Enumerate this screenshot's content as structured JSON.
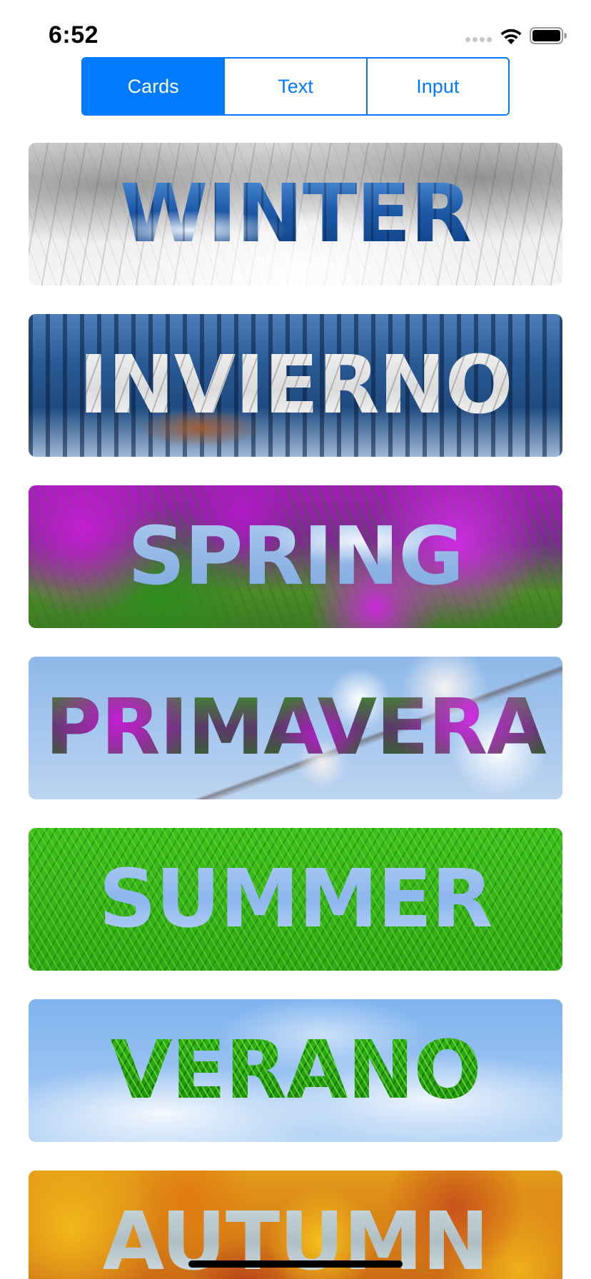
{
  "status_bar": {
    "time": "6:52"
  },
  "segmented_control": {
    "segments": [
      {
        "label": "Cards",
        "selected": true
      },
      {
        "label": "Text",
        "selected": false
      },
      {
        "label": "Input",
        "selected": false
      }
    ]
  },
  "cards": [
    {
      "word": "WINTER"
    },
    {
      "word": "INVIERNO"
    },
    {
      "word": "SPRING"
    },
    {
      "word": "PRIMAVERA"
    },
    {
      "word": "SUMMER"
    },
    {
      "word": "VERANO"
    },
    {
      "word": "AUTUMN"
    }
  ],
  "colors": {
    "accent": "#007aff"
  }
}
